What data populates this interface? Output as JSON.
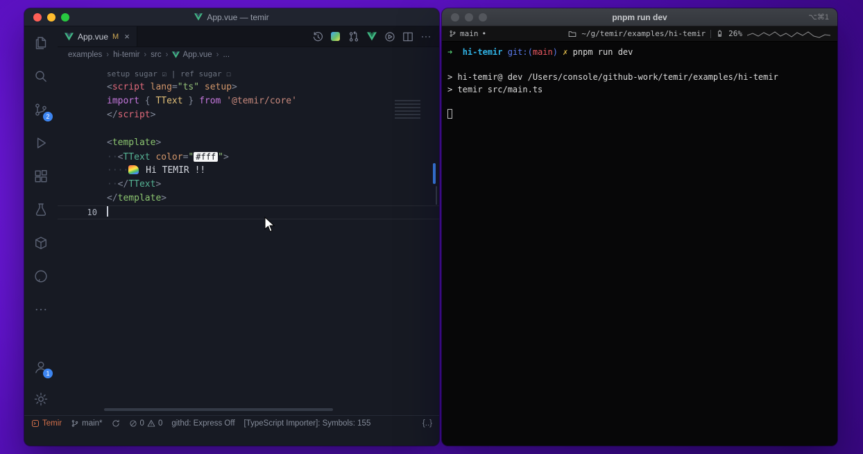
{
  "colors": {
    "accent_blue": "#3d85f0",
    "temir_orange": "#d2704a",
    "vue_green": "#41b883",
    "terminal_cyan": "#30b3e6",
    "git_blue": "#5d7ef2",
    "git_red": "#ef5a63",
    "warn_yellow": "#ddb84a",
    "modified_yellow": "#d0a954"
  },
  "vscode": {
    "titlebar": {
      "title": "App.vue — temir"
    },
    "activity_bar": {
      "icons": [
        "explorer",
        "search",
        "source-control",
        "run-and-debug",
        "extensions",
        "testing",
        "package",
        "github",
        "more"
      ],
      "bottom_icons": [
        "accounts",
        "settings"
      ],
      "scm_badge": "2",
      "account_badge": "1"
    },
    "tab": {
      "label": "App.vue",
      "modified": "M",
      "close": "×"
    },
    "editor_actions": [
      "timeline",
      "changes-gradient",
      "pull-request",
      "vue-devtools",
      "run",
      "split-editor",
      "more-actions"
    ],
    "breadcrumb": {
      "items": [
        "examples",
        "hi-temir",
        "src",
        "App.vue",
        "..."
      ],
      "separator": "›"
    },
    "code": {
      "lines": [
        {
          "lens": true,
          "tokens": [
            {
              "t": "setup sugar ",
              "c": "lens"
            },
            {
              "t": "☑ ",
              "c": "lens"
            },
            {
              "t": "| ref sugar ",
              "c": "lens"
            },
            {
              "t": "☐",
              "c": "lens"
            }
          ]
        },
        {
          "tokens": [
            {
              "t": "<",
              "c": "p"
            },
            {
              "t": "script",
              "c": "tag"
            },
            {
              "t": " ",
              "c": "w"
            },
            {
              "t": "lang",
              "c": "attr"
            },
            {
              "t": "=",
              "c": "p"
            },
            {
              "t": "\"ts\"",
              "c": "str"
            },
            {
              "t": " ",
              "c": "w"
            },
            {
              "t": "setup",
              "c": "attr"
            },
            {
              "t": ">",
              "c": "p"
            }
          ]
        },
        {
          "tokens": [
            {
              "t": "import",
              "c": "kw"
            },
            {
              "t": " { ",
              "c": "p"
            },
            {
              "t": "TText",
              "c": "type"
            },
            {
              "t": " } ",
              "c": "p"
            },
            {
              "t": "from",
              "c": "kw"
            },
            {
              "t": " ",
              "c": "w"
            },
            {
              "t": "'@temir/core'",
              "c": "str2"
            }
          ]
        },
        {
          "tokens": [
            {
              "t": "</",
              "c": "p"
            },
            {
              "t": "script",
              "c": "tag"
            },
            {
              "t": ">",
              "c": "p"
            }
          ]
        },
        {
          "tokens": []
        },
        {
          "tokens": [
            {
              "t": "<",
              "c": "p"
            },
            {
              "t": "template",
              "c": "tpl"
            },
            {
              "t": ">",
              "c": "p"
            }
          ]
        },
        {
          "tokens": [
            {
              "t": "··",
              "c": "ws"
            },
            {
              "t": "<",
              "c": "p"
            },
            {
              "t": "TText",
              "c": "comp"
            },
            {
              "t": " ",
              "c": "w"
            },
            {
              "t": "color",
              "c": "attr"
            },
            {
              "t": "=",
              "c": "p"
            },
            {
              "t": "\"",
              "c": "str"
            },
            {
              "t": "#fff",
              "type": "chip"
            },
            {
              "t": "\"",
              "c": "str"
            },
            {
              "t": ">",
              "c": "p"
            }
          ]
        },
        {
          "tokens": [
            {
              "t": "····",
              "c": "ws"
            },
            {
              "type": "rainbow"
            },
            {
              "t": " Hi TEMIR !!",
              "c": "w"
            }
          ]
        },
        {
          "tokens": [
            {
              "t": "··",
              "c": "ws"
            },
            {
              "t": "</",
              "c": "p"
            },
            {
              "t": "TText",
              "c": "comp"
            },
            {
              "t": ">",
              "c": "p"
            }
          ]
        },
        {
          "tokens": [
            {
              "t": "</",
              "c": "p"
            },
            {
              "t": "template",
              "c": "tpl"
            },
            {
              "t": ">",
              "c": "p"
            }
          ]
        },
        {
          "num": "10",
          "current": true,
          "tokens": [
            {
              "type": "caret"
            }
          ]
        }
      ]
    },
    "statusbar": {
      "temir": "Temir",
      "branch": "main*",
      "errors": "0",
      "warnings": "0",
      "githd": "githd: Express Off",
      "ts_importer": "[TypeScript Importer]: Symbols: 155",
      "right": "{..}"
    }
  },
  "terminal": {
    "titlebar": {
      "title": "pnpm run dev",
      "shortcut": "⌥⌘1"
    },
    "infobar": {
      "branch": "main",
      "dirty": "•",
      "path": "~/g/temir/examples/hi-temir",
      "battery": "26%"
    },
    "lines": [
      {
        "tokens": [
          {
            "t": "➜",
            "c": "green"
          },
          {
            "t": "  ",
            "c": "fg"
          },
          {
            "t": "hi-temir",
            "c": "cyan",
            "b": true
          },
          {
            "t": " ",
            "c": "fg"
          },
          {
            "t": "git:(",
            "c": "blue"
          },
          {
            "t": "main",
            "c": "red"
          },
          {
            "t": ")",
            "c": "blue"
          },
          {
            "t": " ",
            "c": "fg"
          },
          {
            "t": "✗",
            "c": "yellow"
          },
          {
            "t": " pnpm run dev",
            "c": "fg"
          }
        ]
      },
      {
        "tokens": []
      },
      {
        "tokens": [
          {
            "t": "> hi-temir@ dev /Users/console/github-work/temir/examples/hi-temir",
            "c": "fg"
          }
        ]
      },
      {
        "tokens": [
          {
            "t": "> temir src/main.ts",
            "c": "fg"
          }
        ]
      },
      {
        "tokens": []
      },
      {
        "tokens": [
          {
            "type": "hollow"
          }
        ]
      }
    ]
  }
}
